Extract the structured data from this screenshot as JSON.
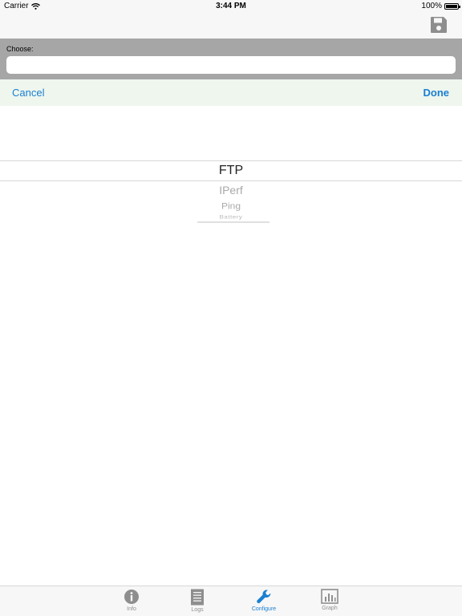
{
  "status_bar": {
    "carrier": "Carrier",
    "time": "3:44 PM",
    "battery": "100%",
    "icons": [
      "wifi-icon",
      "battery-icon"
    ]
  },
  "nav_bar": {
    "save_icon": "floppy-disk-icon"
  },
  "chooser": {
    "label": "Choose:",
    "value": "",
    "placeholder": ""
  },
  "picker_toolbar": {
    "cancel_label": "Cancel",
    "done_label": "Done"
  },
  "picker": {
    "selected_index": 0,
    "items": [
      "FTP",
      "IPerf",
      "Ping",
      "Battery"
    ]
  },
  "tab_bar": {
    "active": "Configure",
    "tabs": [
      {
        "label": "Info",
        "icon": "info-icon"
      },
      {
        "label": "Logs",
        "icon": "document-icon"
      },
      {
        "label": "Configure",
        "icon": "wrench-icon"
      },
      {
        "label": "Graph",
        "icon": "bar-chart-icon"
      }
    ]
  },
  "colors": {
    "accent": "#1a7fd1",
    "toolbar_bg": "#eef6ee",
    "chooser_bg": "#a6a6a6",
    "inactive_tab": "#8e8e8e"
  }
}
